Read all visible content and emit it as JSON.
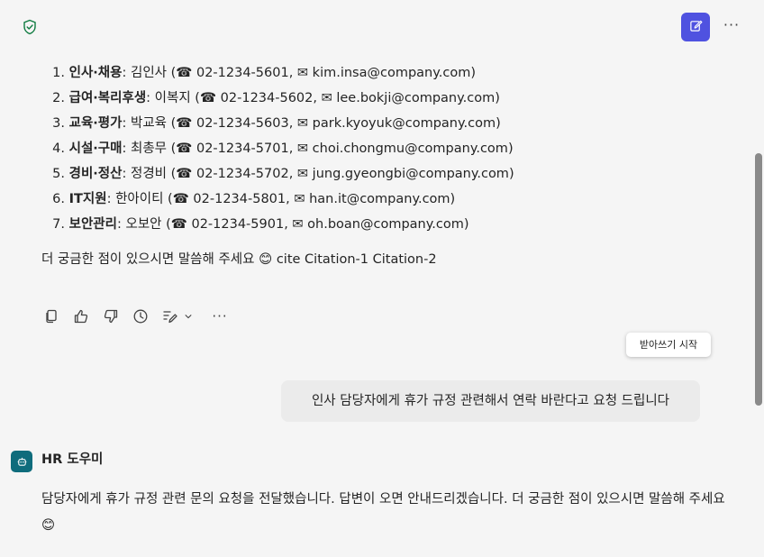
{
  "header": {
    "security_icon": "shield-check-icon",
    "new_chat_icon": "compose-icon",
    "more_label": "···"
  },
  "contacts": [
    {
      "num": "1.",
      "dept": "인사·채용",
      "name": "김인사",
      "phone": "02-1234-5601",
      "email": "kim.insa@company.com"
    },
    {
      "num": "2.",
      "dept": "급여·복리후생",
      "name": "이복지",
      "phone": "02-1234-5602",
      "email": "lee.bokji@company.com"
    },
    {
      "num": "3.",
      "dept": "교육·평가",
      "name": "박교육",
      "phone": "02-1234-5603",
      "email": "park.kyoyuk@company.com"
    },
    {
      "num": "4.",
      "dept": "시설·구매",
      "name": "최총무",
      "phone": "02-1234-5701",
      "email": "choi.chongmu@company.com"
    },
    {
      "num": "5.",
      "dept": "경비·정산",
      "name": "정경비",
      "phone": "02-1234-5702",
      "email": "jung.gyeongbi@company.com"
    },
    {
      "num": "6.",
      "dept": "IT지원",
      "name": "한아이티",
      "phone": "02-1234-5801",
      "email": "han.it@company.com"
    },
    {
      "num": "7.",
      "dept": "보안관리",
      "name": "오보안",
      "phone": "02-1234-5901",
      "email": "oh.boan@company.com"
    }
  ],
  "symbols": {
    "phone": "☎",
    "mail": "✉"
  },
  "message": {
    "follow_up": "더 궁금한 점이 있으시면 말씀해 주세요 😊 cite Citation-1 Citation-2"
  },
  "actions": {
    "copy_icon": "copy-icon",
    "like_icon": "thumbs-up-icon",
    "dislike_icon": "thumbs-down-icon",
    "history_icon": "clock-icon",
    "edit_icon": "edit-icon",
    "more_label": "···"
  },
  "tooltip": {
    "label": "받아쓰기 시작"
  },
  "user_message": {
    "text": "인사 담당자에게 휴가 규정 관련해서 연락 바란다고 요청 드립니다"
  },
  "bot": {
    "name": "HR 도우미",
    "avatar_icon": "bot-icon",
    "reply": "담당자에게 휴가 규정 관련 문의 요청을 전달했습니다. 답변이 오면 안내드리겠습니다. 더 궁금한 점이 있으시면 말씀해 주세요 😊"
  },
  "colors": {
    "accent": "#4f52e0",
    "bot_avatar": "#0f6c7c",
    "shield": "#107c41"
  }
}
